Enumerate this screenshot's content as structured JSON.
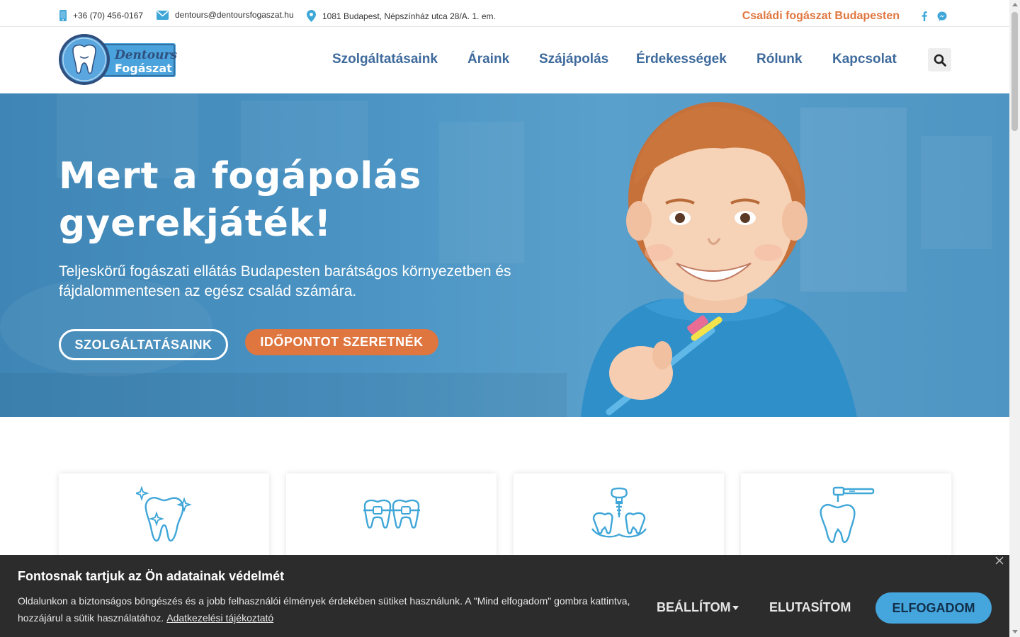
{
  "topbar": {
    "phone": "+36 (70) 456-0167",
    "email": "dentours@dentoursfogaszat.hu",
    "address": "1081 Budapest, Népszínház utca 28/A. 1. em.",
    "tagline": "Családi fogászat Budapesten",
    "social": [
      "facebook-icon",
      "messenger-icon"
    ]
  },
  "logo": {
    "line1": "Dentours",
    "line2": "Fogászat"
  },
  "nav": {
    "items": [
      {
        "label": "Szolgáltatásaink"
      },
      {
        "label": "Áraink"
      },
      {
        "label": "Szájápolás"
      },
      {
        "label": "Érdekességek"
      },
      {
        "label": "Rólunk"
      },
      {
        "label": "Kapcsolat"
      }
    ]
  },
  "hero": {
    "title": "Mert a fogápolás gyerekjáték!",
    "subtitle": "Teljeskörű fogászati ellátás Budapesten barátságos környezetben és fájdalommentesen az egész család számára.",
    "btn_services": "SZOLGÁLTATÁSAINK",
    "btn_appointment": "IDŐPONTOT SZERETNÉK"
  },
  "services": {
    "icons": [
      "tooth-sparkle-icon",
      "braces-icon",
      "implant-icon",
      "dental-drill-icon"
    ]
  },
  "cookie": {
    "title": "Fontosnak tartjuk az Ön adatainak védelmét",
    "text": "Oldalunkon a biztonságos böngészés és a jobb felhasználói élmények érdekében sütiket használunk. A \"Mind elfogadom\" gombra kattintva, hozzájárul a sütik használatához.",
    "link": "Adatkezelési tájékoztató",
    "settings": "BEÁLLÍTOM",
    "reject": "ELUTASÍTOM",
    "accept": "ELFOGADOM"
  },
  "colors": {
    "nav": "#3e6a9c",
    "accent_orange": "#e0763f",
    "hero_blue": "#4a93c3",
    "accept_blue": "#45a6de",
    "icon_blue": "#3fa6d8",
    "banner_bg": "#2c2c2c"
  }
}
